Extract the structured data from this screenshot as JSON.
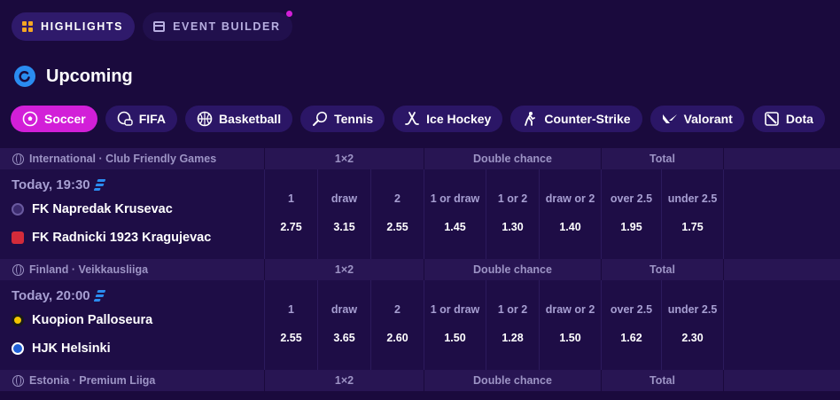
{
  "topnav": {
    "highlights": "HIGHLIGHTS",
    "event_builder": "EVENT BUILDER"
  },
  "heading": {
    "title": "Upcoming"
  },
  "sports": [
    {
      "label": "Soccer",
      "icon": "soccer-icon",
      "active": true
    },
    {
      "label": "FIFA",
      "icon": "fifa-icon"
    },
    {
      "label": "Basketball",
      "icon": "basketball-icon"
    },
    {
      "label": "Tennis",
      "icon": "tennis-icon"
    },
    {
      "label": "Ice Hockey",
      "icon": "ice-hockey-icon"
    },
    {
      "label": "Counter-Strike",
      "icon": "counter-strike-icon"
    },
    {
      "label": "Valorant",
      "icon": "valorant-icon"
    },
    {
      "label": "Dota",
      "icon": "dota-icon"
    }
  ],
  "market_headers": {
    "m1x2": "1×2",
    "double": "Double chance",
    "total": "Total"
  },
  "market_labels": [
    "1",
    "draw",
    "2",
    "1 or draw",
    "1 or 2",
    "draw or 2",
    "over 2.5",
    "under 2.5"
  ],
  "leagues": [
    {
      "name": "International · Club Friendly Games",
      "time": "Today, 19:30",
      "home": {
        "name": "FK Napredak Krusevac",
        "crest_color": "#3b2a6e"
      },
      "away": {
        "name": "FK Radnicki 1923 Kragujevac",
        "crest_color": "#d42b3a"
      },
      "odds": [
        "2.75",
        "3.15",
        "2.55",
        "1.45",
        "1.30",
        "1.40",
        "1.95",
        "1.75"
      ]
    },
    {
      "name": "Finland · Veikkausliiga",
      "time": "Today, 20:00",
      "home": {
        "name": "Kuopion Palloseura",
        "crest_color": "#f2c500"
      },
      "away": {
        "name": "HJK Helsinki",
        "crest_color": "#1f5fd6"
      },
      "odds": [
        "2.55",
        "3.65",
        "2.60",
        "1.50",
        "1.28",
        "1.50",
        "1.62",
        "2.30"
      ]
    },
    {
      "name": "Estonia · Premium Liiga"
    }
  ],
  "colors": {
    "accent": "#d21fd8",
    "background": "#1a0a3d",
    "blue": "#2a8cf0"
  }
}
